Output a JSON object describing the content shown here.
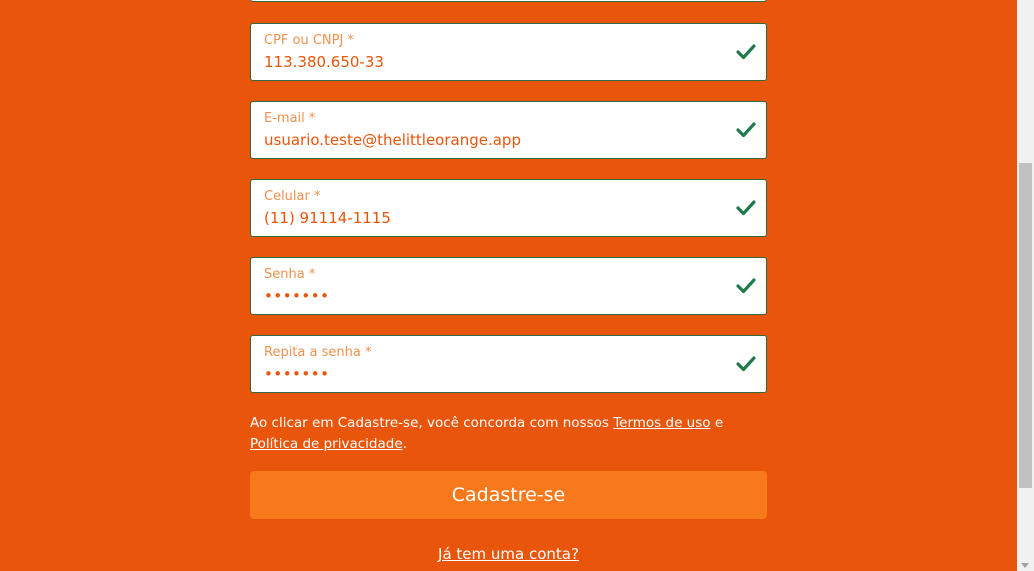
{
  "fields": [
    {
      "id": "cpf",
      "label": "CPF ou CNPJ *",
      "value": "113.380.650-33"
    },
    {
      "id": "email",
      "label": "E-mail *",
      "value": "usuario.teste@thelittleorange.app"
    },
    {
      "id": "phone",
      "label": "Celular *",
      "value": "(11) 91114-1115"
    },
    {
      "id": "password",
      "label": "Senha *",
      "value": "•••••••"
    },
    {
      "id": "password-confirm",
      "label": "Repita a senha *",
      "value": "•••••••"
    }
  ],
  "terms": {
    "prefix": "Ao clicar em Cadastre-se, você concorda com nossos ",
    "terms_link": "Termos de uso",
    "middle": " e ",
    "privacy_link": "Política de privacidade",
    "suffix": "."
  },
  "submit_label": "Cadastre-se",
  "login_link": "Já tem uma conta?",
  "colors": {
    "background": "#e9550a",
    "button": "#f7791b",
    "valid": "#1f7a4d"
  }
}
